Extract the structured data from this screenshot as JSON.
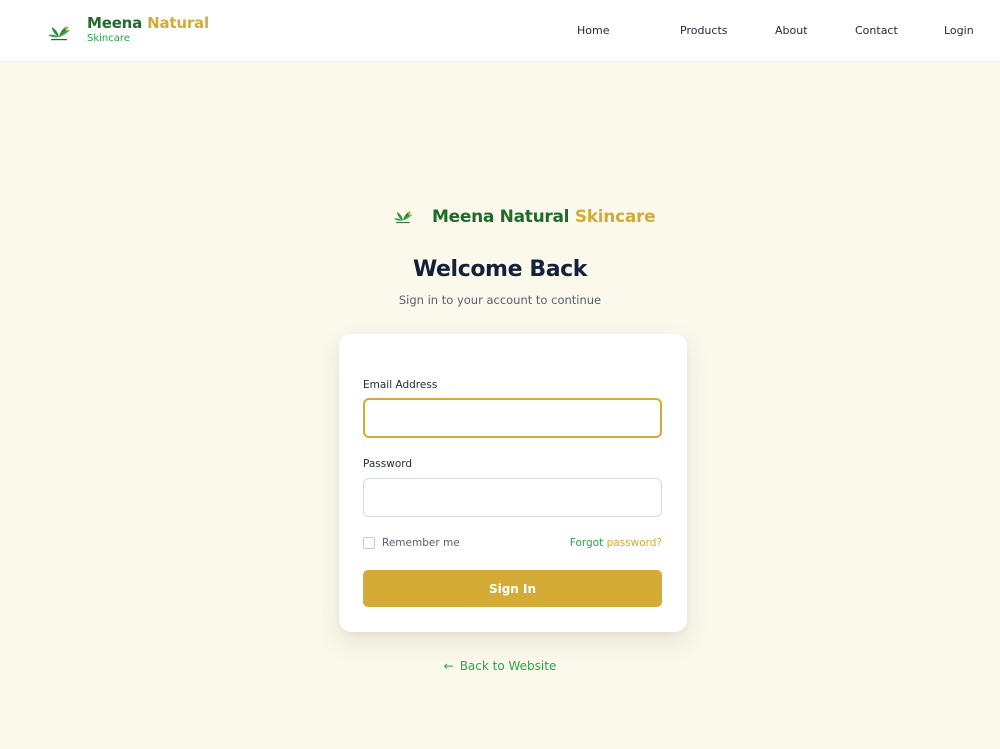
{
  "header": {
    "brand": {
      "name_part1": "Meena",
      "name_part2": "Natural",
      "subtitle": "Skincare"
    },
    "nav": [
      {
        "label": "Home"
      },
      {
        "label": "Products"
      },
      {
        "label": "About"
      },
      {
        "label": "Contact"
      },
      {
        "label": "Login"
      }
    ]
  },
  "main": {
    "brand": {
      "part1": "Meena Natural",
      "part2": "Skincare"
    },
    "title": "Welcome Back",
    "subtitle": "Sign in to your account to continue",
    "form": {
      "email_label": "Email Address",
      "email_value": "",
      "password_label": "Password",
      "password_value": "",
      "remember_label": "Remember me",
      "remember_checked": false,
      "forgot_part1": "Forgot",
      "forgot_part2": "password?",
      "submit_label": "Sign In"
    },
    "back_label": "Back to Website",
    "back_icon": "arrow-left-icon"
  },
  "colors": {
    "brand_green": "#1f6b2c",
    "accent_gold": "#d4ab35",
    "link_green": "#2aa54a",
    "page_background": "#fbf9ec"
  }
}
